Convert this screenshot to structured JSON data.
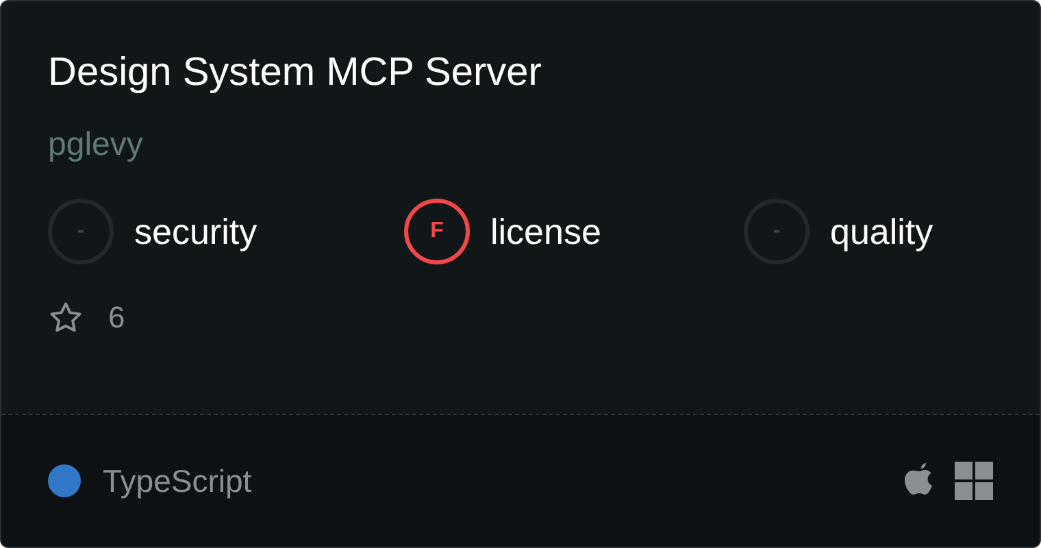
{
  "title": "Design System MCP Server",
  "author": "pglevy",
  "scores": [
    {
      "grade": "-",
      "label": "security",
      "color": "#22282b"
    },
    {
      "grade": "F",
      "label": "license",
      "color": "#f04848"
    },
    {
      "grade": "-",
      "label": "quality",
      "color": "#22282b"
    }
  ],
  "stars": "6",
  "language": {
    "name": "TypeScript",
    "color": "#3178c6"
  },
  "platforms": [
    {
      "kind": "apple"
    },
    {
      "kind": "windows"
    }
  ]
}
